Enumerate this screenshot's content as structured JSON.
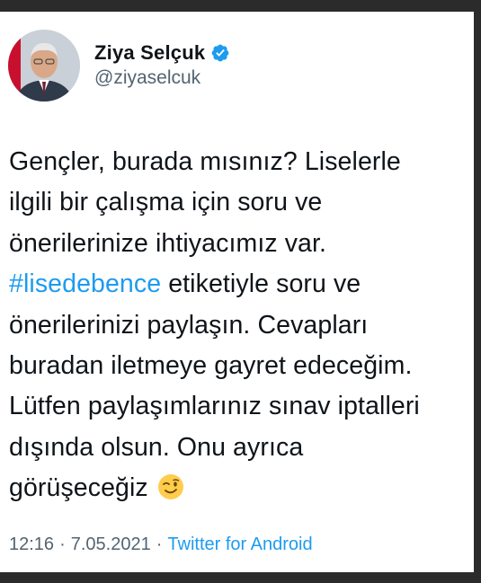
{
  "author": {
    "name": "Ziya Selçuk",
    "handle": "@ziyaselcuk",
    "verified": true
  },
  "tweet": {
    "lines": [
      "Gençler, burada mısınız? Liselerle",
      "ilgili bir çalışma için soru ve",
      "önerilerinize ihtiyacımız var."
    ],
    "hashtag": "#lisedebence",
    "hashtag_rest": " etiketiyle soru ve",
    "lines_after": [
      "önerilerinizi paylaşın. Cevapları",
      "buradan iletmeye gayret edeceğim.",
      "Lütfen paylaşımlarınız sınav iptalleri",
      "dışında olsun. Onu ayrıca",
      "görüşeceğiz"
    ],
    "emoji": "winking-face"
  },
  "meta": {
    "time": "12:16",
    "separator": "·",
    "date": "7.05.2021",
    "source": "Twitter for Android"
  },
  "colors": {
    "link": "#1d9bf0",
    "text": "#0f1419",
    "secondary": "#536471"
  }
}
